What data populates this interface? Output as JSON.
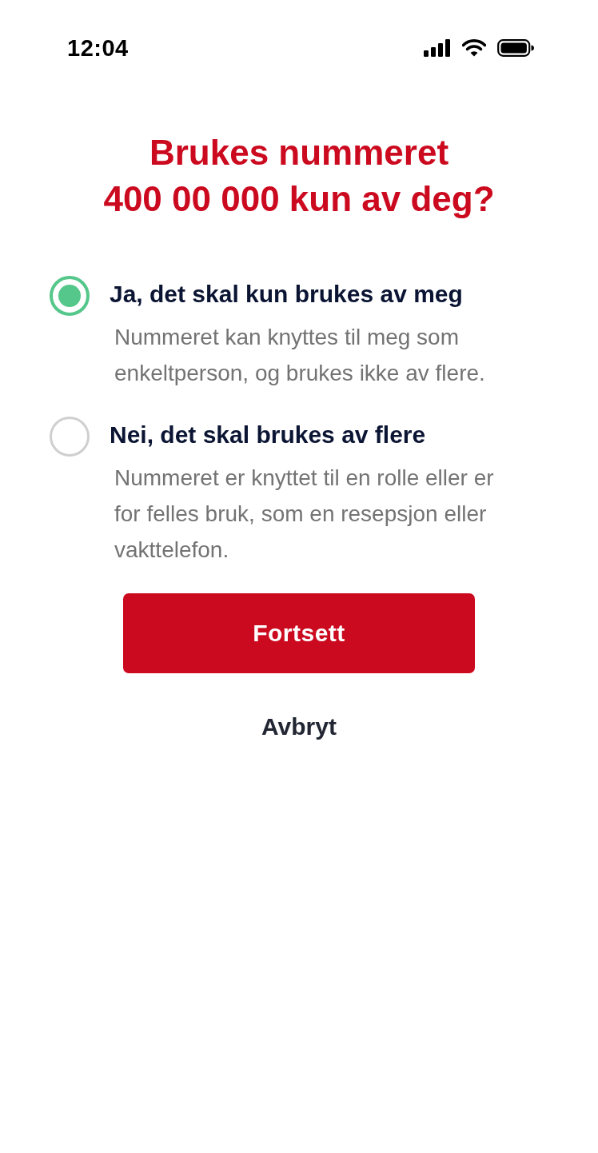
{
  "status_bar": {
    "time": "12:04"
  },
  "title": "Brukes nummeret\n400 00 000 kun av deg?",
  "options": [
    {
      "label": "Ja, det skal kun brukes av meg",
      "description": "Nummeret kan knyttes til meg som enkeltperson, og brukes ikke av flere.",
      "selected": true
    },
    {
      "label": "Nei, det skal brukes av flere",
      "description": "Nummeret er knyttet til en rolle eller er for felles bruk, som en resepsjon eller vakttelefon.",
      "selected": false
    }
  ],
  "actions": [
    {
      "kind": "primary",
      "label": "Fortsett"
    },
    {
      "kind": "text",
      "label": "Avbryt"
    }
  ]
}
